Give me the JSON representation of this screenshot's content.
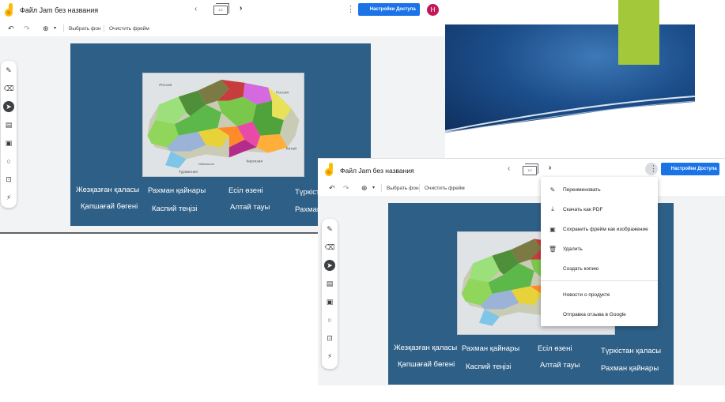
{
  "background_slide": {
    "accent_colors": {
      "blue": "#1d4f8c",
      "green": "#a3c93a"
    }
  },
  "jam_back": {
    "title": "Файл Jam без названия",
    "frame_indicator": "1/2",
    "access_button": "Настройки Доступа",
    "avatar_initial": "Н",
    "toolbar": {
      "set_background": "Выбрать фон",
      "clear_frame": "Очистить фрейм"
    },
    "labels": [
      "Жезқазған қаласы",
      "Рахман қайнары",
      "Есіл өзені",
      "Түркіст",
      "Қапшағай бөгені",
      "Каспий теңізі",
      "Алтай тауы",
      "Рахман"
    ]
  },
  "jam_front": {
    "title": "Файл Jam без названия",
    "frame_indicator": "1/2",
    "access_button": "Настройки Доступа",
    "toolbar": {
      "set_background": "Выбрать фон",
      "clear_frame": "Очистить фрейм"
    },
    "labels": [
      "Жезқазған қаласы",
      "Рахман қайнары",
      "Есіл өзені",
      "Түркістан қаласы",
      "Қапшағай бөгені",
      "Каспий теңізі",
      "Алтай тауы",
      "Рахман қайнары"
    ]
  },
  "map_labels": {
    "russia": "Россия",
    "russia2": "Россия",
    "china": "Китай",
    "kyrgyzstan": "Киргизия",
    "turkmenistan": "Туркмения",
    "uzbekistan": "Узбекистан"
  },
  "menu": {
    "items": [
      {
        "icon": "pencil-icon",
        "label": "Переименовать"
      },
      {
        "icon": "download-icon",
        "label": "Скачать как PDF"
      },
      {
        "icon": "image-icon",
        "label": "Сохранить фрейм как изображение"
      },
      {
        "icon": "trash-icon",
        "label": "Удалить"
      },
      {
        "icon": "",
        "label": "Создать копию"
      },
      {
        "icon": "",
        "label": "Новости о продукте"
      },
      {
        "icon": "",
        "label": "Отправка отзыва в Google"
      }
    ]
  },
  "colors": {
    "accent": "#1a73e8",
    "frame_bg": "#2e5f86",
    "avatar": "#c2185b"
  }
}
